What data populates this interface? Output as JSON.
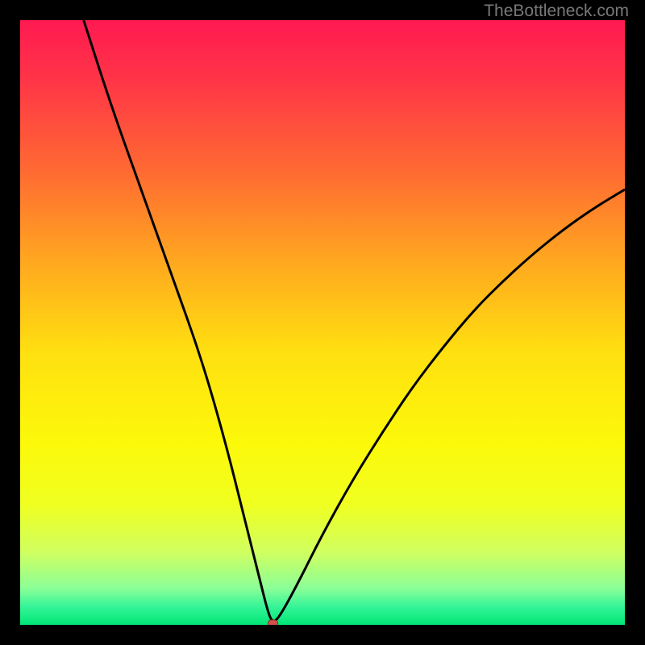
{
  "watermark": "TheBottleneck.com",
  "chart_data": {
    "type": "line",
    "title": "",
    "xlabel": "",
    "ylabel": "",
    "xlim": [
      0,
      100
    ],
    "ylim": [
      0,
      100
    ],
    "background": {
      "type": "vertical-gradient",
      "stops": [
        {
          "offset": 0.0,
          "color": "#ff1a52"
        },
        {
          "offset": 0.1,
          "color": "#ff3547"
        },
        {
          "offset": 0.25,
          "color": "#ff6a32"
        },
        {
          "offset": 0.4,
          "color": "#ffa81f"
        },
        {
          "offset": 0.55,
          "color": "#ffe010"
        },
        {
          "offset": 0.7,
          "color": "#fcf90a"
        },
        {
          "offset": 0.8,
          "color": "#f0ff20"
        },
        {
          "offset": 0.88,
          "color": "#d0ff60"
        },
        {
          "offset": 0.94,
          "color": "#8aff98"
        },
        {
          "offset": 0.97,
          "color": "#35f497"
        },
        {
          "offset": 1.0,
          "color": "#00e676"
        }
      ],
      "note": "gradient represents bottleneck severity from red (high) at top to green (low) at bottom"
    },
    "series": [
      {
        "name": "bottleneck-curve",
        "type": "line",
        "x": [
          10.5,
          15,
          20,
          25,
          30,
          34,
          37,
          39.5,
          41,
          41.8,
          43,
          46,
          50,
          55,
          60,
          65,
          70,
          75,
          80,
          85,
          90,
          95,
          100
        ],
        "y": [
          100,
          86,
          72,
          58,
          44,
          30,
          18,
          8,
          2,
          0.3,
          1.5,
          7,
          15,
          24,
          32,
          39.5,
          46,
          52,
          57,
          61.5,
          65.5,
          69,
          72
        ],
        "color": "#000000",
        "line_width": 3
      }
    ],
    "marker": {
      "name": "optimal-point",
      "x": 41.8,
      "y": 0.3,
      "color": "#d2524a",
      "shape": "rounded-square",
      "size": 12
    },
    "legend": null,
    "grid": false,
    "axes_visible": false
  }
}
